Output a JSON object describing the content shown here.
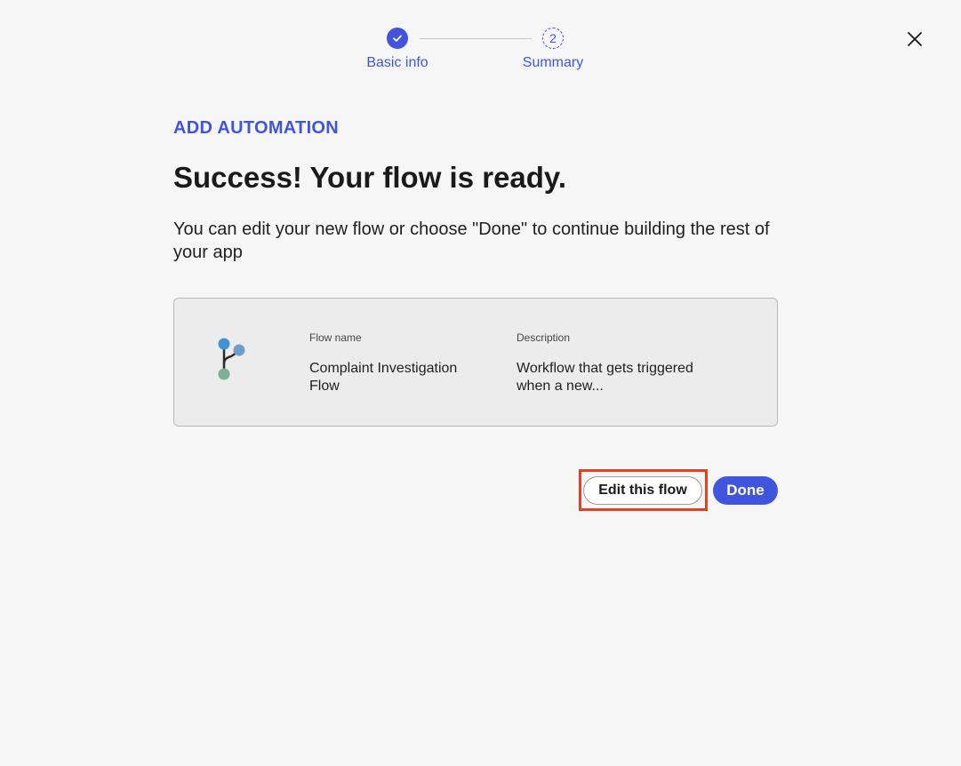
{
  "stepper": {
    "steps": [
      {
        "label": "Basic info",
        "state": "completed",
        "icon": "check-icon"
      },
      {
        "label": "Summary",
        "state": "current",
        "number": "2"
      }
    ],
    "accent_color": "#4154de"
  },
  "close": {
    "icon": "close-icon"
  },
  "dialog": {
    "eyebrow": "ADD AUTOMATION",
    "headline": "Success! Your flow is ready.",
    "description": "You can edit your new flow or choose \"Done\" to continue building the rest of your app"
  },
  "flow_card": {
    "icon": "flow-branch-icon",
    "name_label": "Flow name",
    "name_value": "Complaint Investigation Flow",
    "description_label": "Description",
    "description_value": "Workflow that gets triggered when a new..."
  },
  "actions": {
    "edit_label": "Edit this flow",
    "done_label": "Done",
    "highlight_color": "#e8401c"
  }
}
